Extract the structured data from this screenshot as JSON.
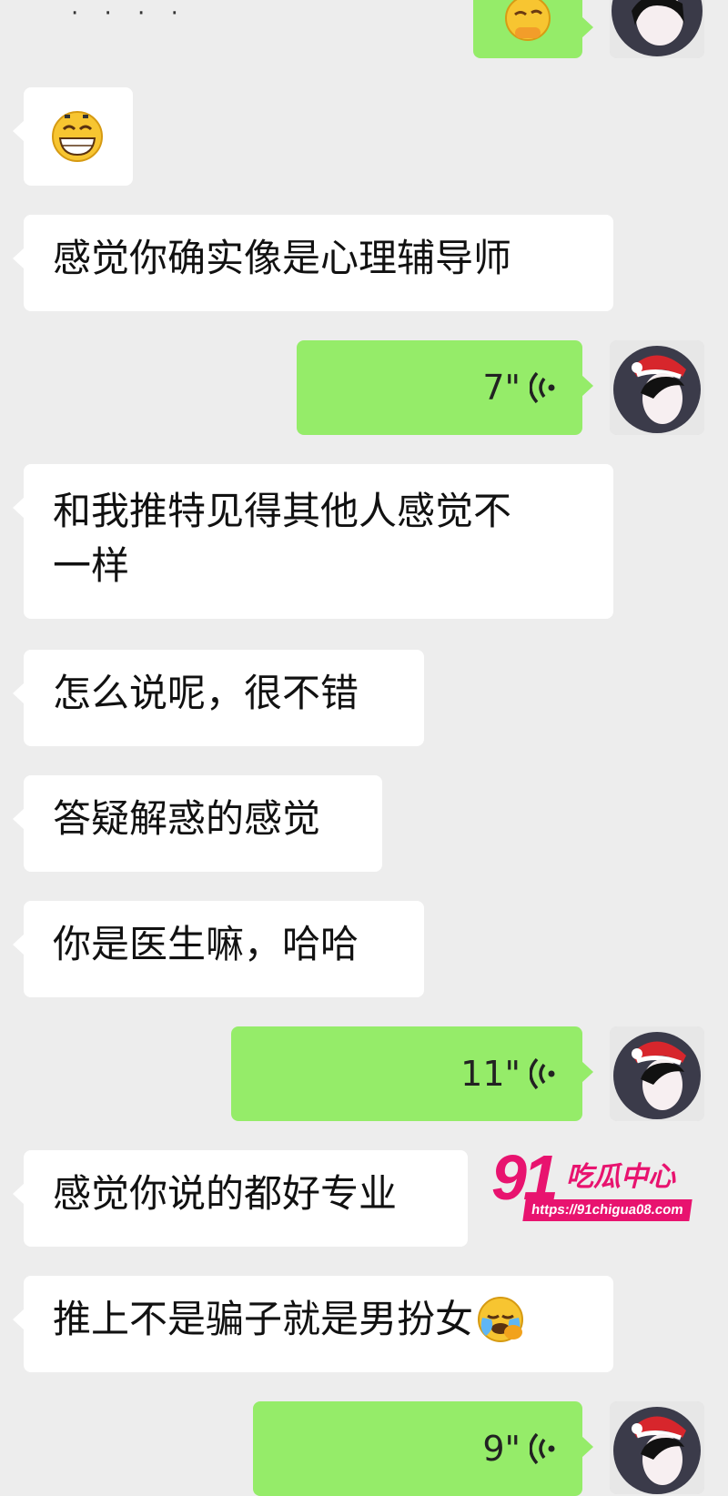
{
  "top": {
    "typing_dots": "· · · ·"
  },
  "messages": [
    {
      "id": "m1",
      "text": "感觉你确实像是心理辅导师"
    },
    {
      "id": "m2",
      "duration": "7\""
    },
    {
      "id": "m3",
      "line1": "和我推特见得其他人感觉不",
      "line2": "一样"
    },
    {
      "id": "m4",
      "text": "怎么说呢，很不错"
    },
    {
      "id": "m5",
      "text": "答疑解惑的感觉"
    },
    {
      "id": "m6",
      "text": "你是医生嘛，哈哈"
    },
    {
      "id": "m7",
      "duration": "11\""
    },
    {
      "id": "m8",
      "text": "感觉你说的都好专业"
    },
    {
      "id": "m9",
      "text": "推上不是骗子就是男扮女"
    },
    {
      "id": "m10",
      "duration": "9\""
    }
  ],
  "icons": {
    "grin_emoji": "grinning-face-icon",
    "thinking_emoji": "thinking-face-icon",
    "crying_emoji": "crying-face-icon",
    "voice_icon": "voice-wave-icon",
    "avatar": "avatar-santa-hat-girl"
  },
  "watermark": {
    "logo_number": "91",
    "logo_text": "吃瓜中心",
    "url": "https://91chigua08.com"
  },
  "colors": {
    "background": "#ededed",
    "incoming_bubble": "#ffffff",
    "outgoing_bubble": "#95ec69",
    "watermark_accent": "#e8136f"
  }
}
